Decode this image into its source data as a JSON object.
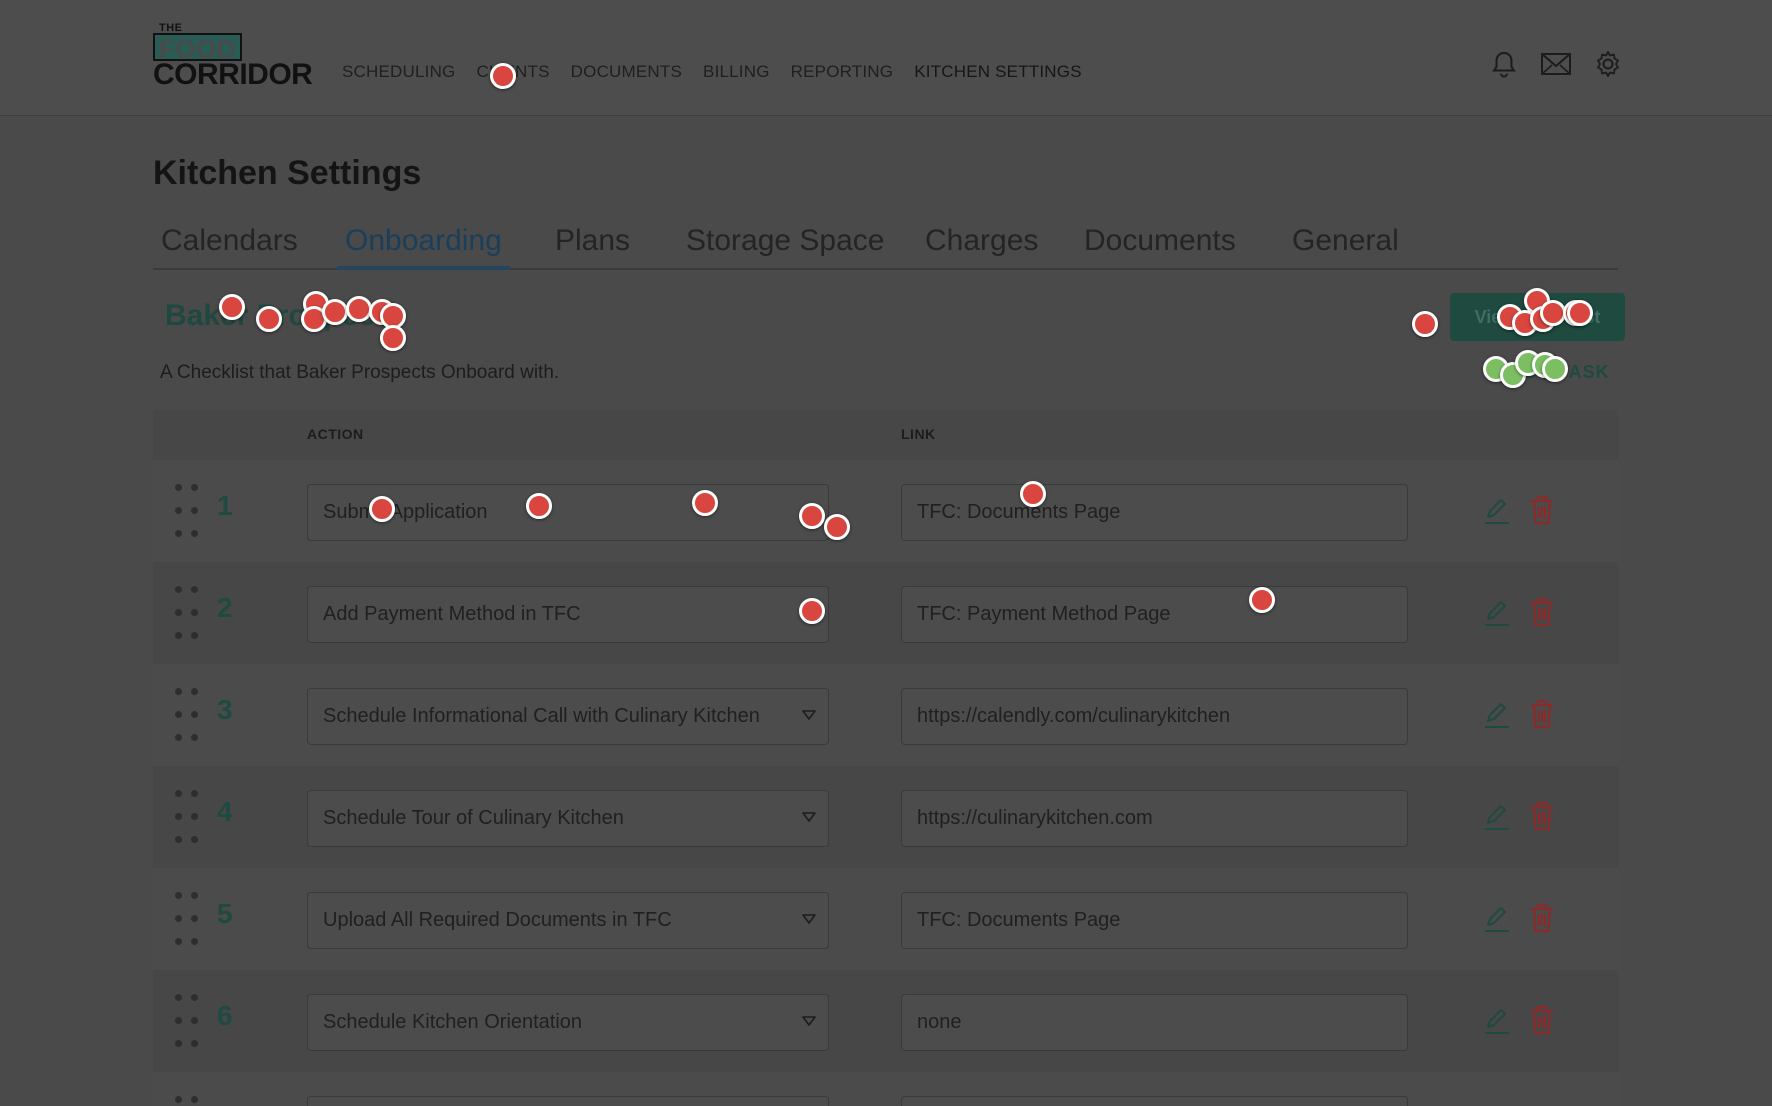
{
  "header": {
    "logo": {
      "the": "THE",
      "food": "FOOD",
      "corridor": "CORRIDOR"
    },
    "nav": [
      "SCHEDULING",
      "CLIENTS",
      "DOCUMENTS",
      "BILLING",
      "REPORTING",
      "KITCHEN SETTINGS"
    ],
    "icons": [
      "bell-icon",
      "mail-icon",
      "gear-icon"
    ]
  },
  "page": {
    "title": "Kitchen Settings",
    "tabs": [
      "Calendars",
      "Onboarding",
      "Plans",
      "Storage Space",
      "Charges",
      "Documents",
      "General"
    ],
    "active_tab": "Onboarding"
  },
  "checklist": {
    "title": "Baker Prospect",
    "description": "A Checklist that Baker Prospects Onboard with.",
    "primary_button": "View Checklist",
    "add_task": "ADD TASK"
  },
  "table": {
    "columns": {
      "action": "ACTION",
      "link": "LINK"
    },
    "rows": [
      {
        "num": "1",
        "action": "Submit Application",
        "link": "TFC: Documents Page"
      },
      {
        "num": "2",
        "action": "Add Payment Method in TFC",
        "link": "TFC: Payment Method Page"
      },
      {
        "num": "3",
        "action": "Schedule Informational Call with Culinary Kitchen",
        "link": "https://calendly.com/culinarykitchen"
      },
      {
        "num": "4",
        "action": "Schedule Tour of Culinary Kitchen",
        "link": "https://culinarykitchen.com"
      },
      {
        "num": "5",
        "action": "Upload All Required Documents in TFC",
        "link": "TFC: Documents Page"
      },
      {
        "num": "6",
        "action": "Schedule Kitchen Orientation",
        "link": "none"
      }
    ]
  },
  "colors": {
    "brand_green": "#1f4a40",
    "tab_active": "#24465c",
    "click_dot": "#d9463f",
    "click_dot_alt": "#7bbf62",
    "trash": "#8a2a2a"
  }
}
